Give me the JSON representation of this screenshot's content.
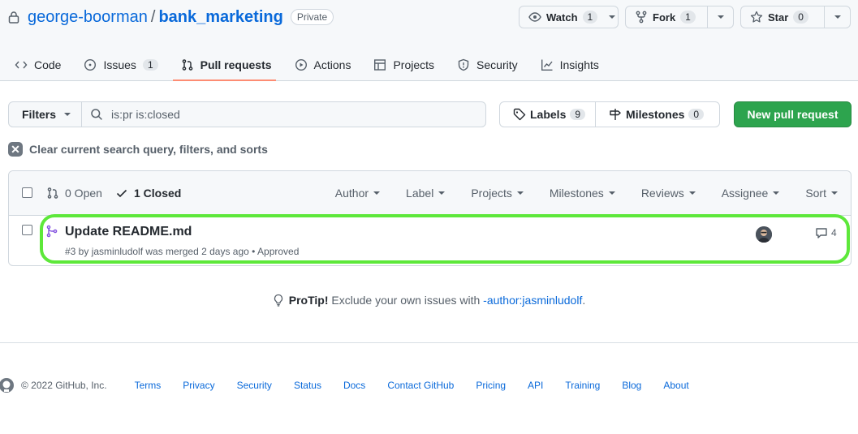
{
  "repo": {
    "owner": "george-boorman",
    "name": "bank_marketing",
    "visibility": "Private"
  },
  "actions": {
    "watch": {
      "label": "Watch",
      "count": "1"
    },
    "fork": {
      "label": "Fork",
      "count": "1"
    },
    "star": {
      "label": "Star",
      "count": "0"
    }
  },
  "tabs": [
    {
      "label": "Code",
      "icon": "code-icon"
    },
    {
      "label": "Issues",
      "count": "1",
      "icon": "issue-icon"
    },
    {
      "label": "Pull requests",
      "icon": "pull-request-icon",
      "selected": true
    },
    {
      "label": "Actions",
      "icon": "play-icon"
    },
    {
      "label": "Projects",
      "icon": "table-icon"
    },
    {
      "label": "Security",
      "icon": "shield-icon"
    },
    {
      "label": "Insights",
      "icon": "graph-icon"
    }
  ],
  "filterbar": {
    "filters_label": "Filters",
    "search_value": "is:pr is:closed",
    "labels": {
      "label": "Labels",
      "count": "9"
    },
    "milestones": {
      "label": "Milestones",
      "count": "0"
    },
    "new_pr_label": "New pull request",
    "clear_label": "Clear current search query, filters, and sorts"
  },
  "list": {
    "open_label": "0 Open",
    "closed_label": "1 Closed",
    "filters": [
      "Author",
      "Label",
      "Projects",
      "Milestones",
      "Reviews",
      "Assignee",
      "Sort"
    ],
    "items": [
      {
        "title": "Update README.md",
        "meta": "#3 by jasminludolf was merged 2 days ago",
        "status": "• Approved",
        "comments": "4"
      }
    ]
  },
  "protip": {
    "prefix": "ProTip!",
    "text": "Exclude your own issues with",
    "link": "-author:jasminludolf",
    "suffix": "."
  },
  "footer": {
    "copyright": "© 2022 GitHub, Inc.",
    "links": [
      "Terms",
      "Privacy",
      "Security",
      "Status",
      "Docs",
      "Contact GitHub",
      "Pricing",
      "API",
      "Training",
      "Blog",
      "About"
    ]
  },
  "colors": {
    "accent": "#0969da",
    "primary_button": "#2da44e",
    "merged": "#8250df",
    "highlight": "#5de83a",
    "tab_underline": "#fd8c73"
  }
}
